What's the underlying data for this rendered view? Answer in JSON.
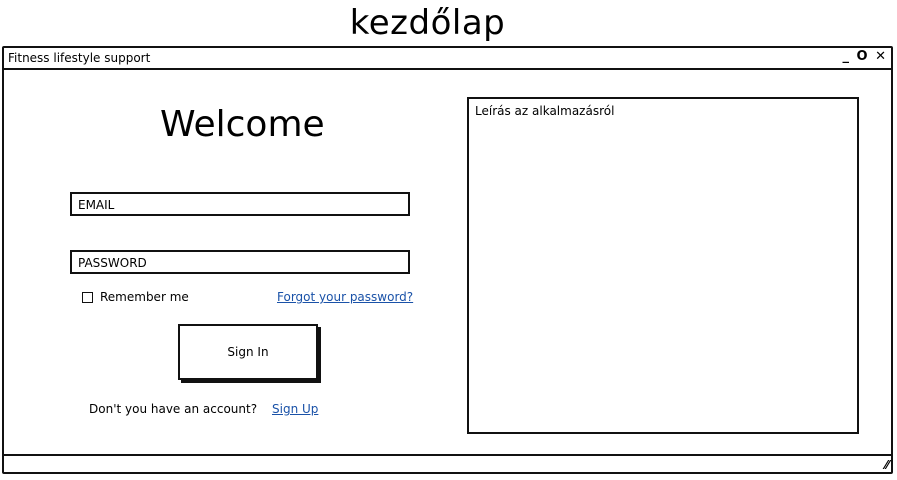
{
  "page_title": "kezdőlap",
  "window": {
    "title": "Fitness lifestyle support",
    "controls": {
      "minimize": "_",
      "maximize": "O",
      "close": "✕"
    },
    "resize_grip": "⁄⁄"
  },
  "login": {
    "heading": "Welcome",
    "email_placeholder": "EMAIL",
    "password_placeholder": "PASSWORD",
    "remember_label": "Remember me",
    "forgot_link": "Forgot your password?",
    "signin_label": "Sign In",
    "no_account_text": "Don't you have an account?",
    "signup_link": "Sign Up"
  },
  "description": {
    "text": "Leírás az alkalmazásról"
  },
  "colors": {
    "link": "#1a52a8",
    "border": "#111111",
    "background": "#ffffff"
  }
}
